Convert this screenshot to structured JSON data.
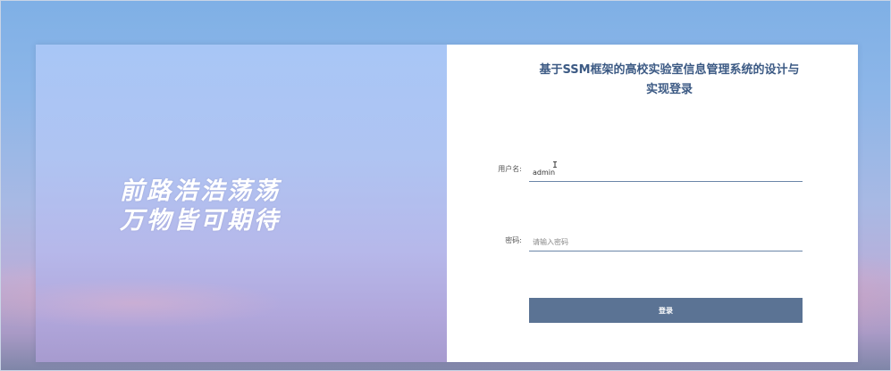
{
  "slogan": {
    "line1": "前路浩浩荡荡",
    "line2": "万物皆可期待"
  },
  "login": {
    "title_line1": "基于SSM框架的高校实验室信息管理系统的设计与",
    "title_line2": "实现登录",
    "username_label": "用户名:",
    "username_value": "admin",
    "password_label": "密码:",
    "password_placeholder": "请输入密码",
    "submit_label": "登录"
  },
  "colors": {
    "title": "#3c5a84",
    "button": "#5b7394",
    "input_underline": "#6b86a8"
  }
}
